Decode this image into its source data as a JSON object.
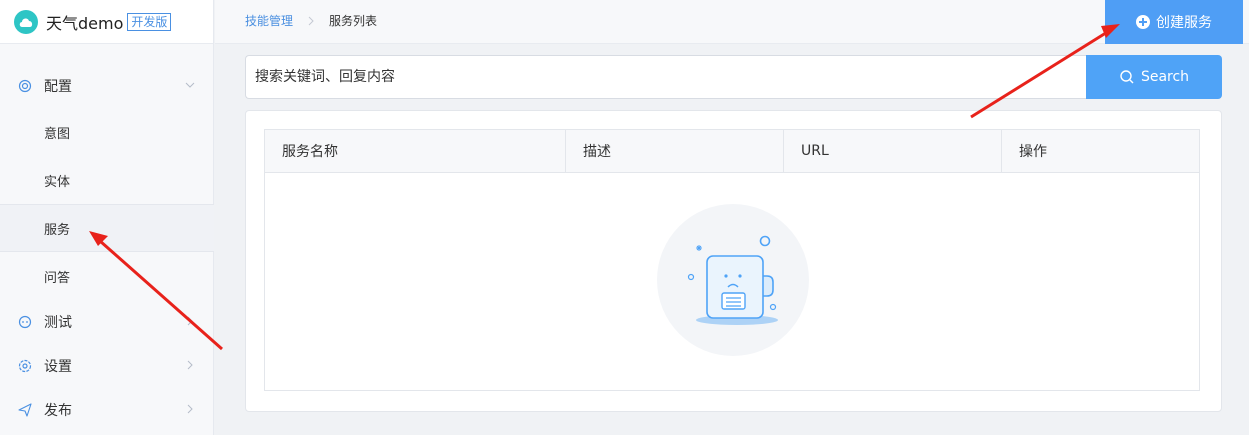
{
  "brand": {
    "name": "天气demo",
    "badge": "开发版"
  },
  "sidebar": {
    "groups": [
      {
        "label": "配置",
        "icon": "settings-circle-icon",
        "expanded": true,
        "items": [
          {
            "label": "意图",
            "active": false
          },
          {
            "label": "实体",
            "active": false
          },
          {
            "label": "服务",
            "active": true
          },
          {
            "label": "问答",
            "active": false
          }
        ]
      },
      {
        "label": "测试",
        "icon": "test-icon",
        "expanded": false
      },
      {
        "label": "设置",
        "icon": "gear-icon",
        "expanded": false
      },
      {
        "label": "发布",
        "icon": "send-icon",
        "expanded": false
      }
    ]
  },
  "breadcrumb": {
    "parent": "技能管理",
    "current": "服务列表"
  },
  "header": {
    "create_label": "创建服务"
  },
  "search": {
    "placeholder": "搜索关键词、回复内容",
    "button_label": "Search"
  },
  "table": {
    "columns": [
      "服务名称",
      "描述",
      "URL",
      "操作"
    ],
    "rows": []
  },
  "colors": {
    "primary": "#4f9ef5",
    "link": "#4a8fe0",
    "annotation_arrow": "#e8221b"
  }
}
